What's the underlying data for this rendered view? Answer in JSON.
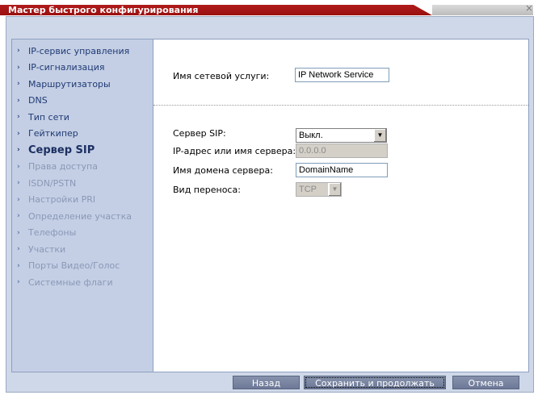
{
  "window": {
    "title": "Мастер быстрого конфигурирования",
    "close_glyph": "×"
  },
  "sidebar": {
    "items": [
      {
        "label": "IP-сервис управления",
        "state": "enabled"
      },
      {
        "label": "IP-сигнализация",
        "state": "enabled"
      },
      {
        "label": "Маршрутизаторы",
        "state": "enabled"
      },
      {
        "label": "DNS",
        "state": "enabled"
      },
      {
        "label": "Тип сети",
        "state": "enabled"
      },
      {
        "label": "Гейткипер",
        "state": "enabled"
      },
      {
        "label": "Сервер SIP",
        "state": "active"
      },
      {
        "label": "Права доступа",
        "state": "disabled"
      },
      {
        "label": "ISDN/PSTN",
        "state": "disabled"
      },
      {
        "label": "Настройки PRI",
        "state": "disabled"
      },
      {
        "label": "Определение участка",
        "state": "disabled"
      },
      {
        "label": "Телефоны",
        "state": "disabled"
      },
      {
        "label": "Участки",
        "state": "disabled"
      },
      {
        "label": "Порты Видео/Голос",
        "state": "disabled"
      },
      {
        "label": "Системные флаги",
        "state": "disabled"
      }
    ],
    "arrow_glyph": "›"
  },
  "form": {
    "service_name_label": "Имя сетевой услуги:",
    "service_name_value": "IP Network Service",
    "sip_server_label": "Сервер SIP:",
    "sip_server_value": "Выкл.",
    "server_address_label": "IP-адрес или имя сервера:",
    "server_address_value": "0.0.0.0",
    "domain_label": "Имя домена сервера:",
    "domain_value": "DomainName",
    "transport_label": "Вид переноса:",
    "transport_value": "TCP",
    "dropdown_glyph": "▼"
  },
  "footer": {
    "back_label": "Назад",
    "save_continue_label": "Сохранить и продолжать",
    "cancel_label": "Отмена"
  },
  "colors": {
    "title_bar": "#a81515",
    "button_bg": "#7783a0",
    "sidebar_bg": "#c4cfe5"
  }
}
